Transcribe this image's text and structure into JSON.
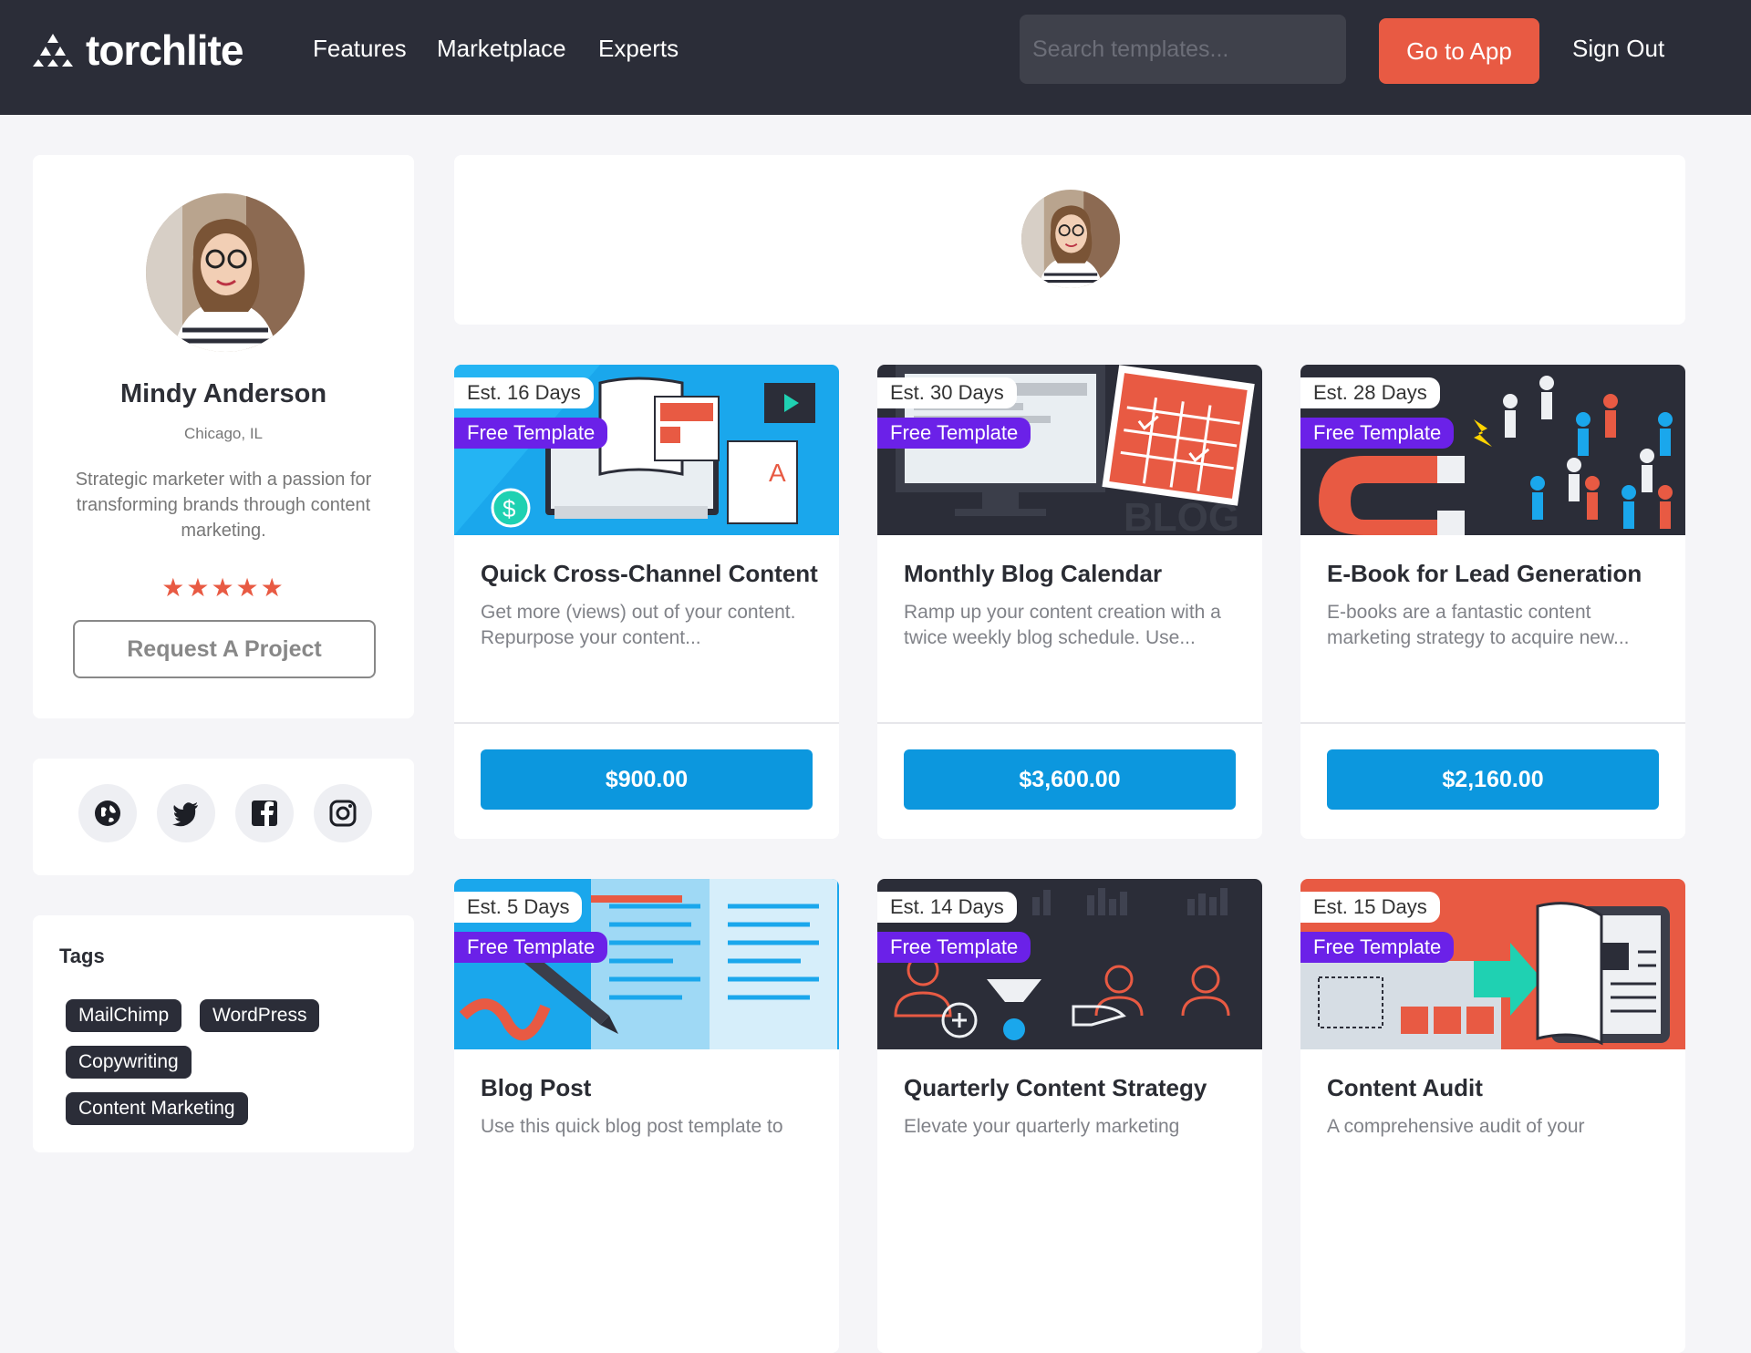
{
  "nav": {
    "logo_text": "torchlite",
    "links": [
      "Features",
      "Marketplace",
      "Experts"
    ],
    "search_placeholder": "Search templates...",
    "go_to_app": "Go to App",
    "sign_out": "Sign Out"
  },
  "profile": {
    "name": "Mindy Anderson",
    "location": "Chicago, IL",
    "bio": "Strategic marketer with a passion for transforming brands through content marketing.",
    "rating_stars": "★★★★★",
    "rating": 5,
    "request_button": "Request A Project"
  },
  "social": [
    "globe-icon",
    "twitter-icon",
    "facebook-icon",
    "instagram-icon"
  ],
  "tags": {
    "title": "Tags",
    "items": [
      "MailChimp",
      "WordPress",
      "Copywriting",
      "Content Marketing"
    ]
  },
  "templates": [
    {
      "days": "Est. 16 Days",
      "badge": "Free Template",
      "title": "Quick Cross-Channel Content",
      "desc": "Get more (views) out of your content. Repurpose your content...",
      "price": "$900.00",
      "image_color": "#1aa7ec"
    },
    {
      "days": "Est. 30 Days",
      "badge": "Free Template",
      "title": "Monthly Blog Calendar",
      "desc": "Ramp up your content creation with a twice weekly blog schedule. Use...",
      "price": "$3,600.00",
      "image_color": "#2b2d38"
    },
    {
      "days": "Est. 28 Days",
      "badge": "Free Template",
      "title": "E-Book for Lead Generation",
      "desc": "E-books are a fantastic content marketing strategy to acquire new...",
      "price": "$2,160.00",
      "image_color": "#2b2d38"
    },
    {
      "days": "Est. 5 Days",
      "badge": "Free Template",
      "title": "Blog Post",
      "desc": "Use this quick blog post template to",
      "price": "",
      "image_color": "#1aa7ec"
    },
    {
      "days": "Est. 14 Days",
      "badge": "Free Template",
      "title": "Quarterly Content Strategy",
      "desc": "Elevate your quarterly marketing",
      "price": "",
      "image_color": "#2b2d38"
    },
    {
      "days": "Est. 15 Days",
      "badge": "Free Template",
      "title": "Content Audit",
      "desc": "A comprehensive audit of your",
      "price": "",
      "image_color": "#e85a43"
    }
  ],
  "colors": {
    "nav_bg": "#2b2d38",
    "accent": "#e85a43",
    "price_button": "#0c97de",
    "badge": "#6b21e8"
  }
}
